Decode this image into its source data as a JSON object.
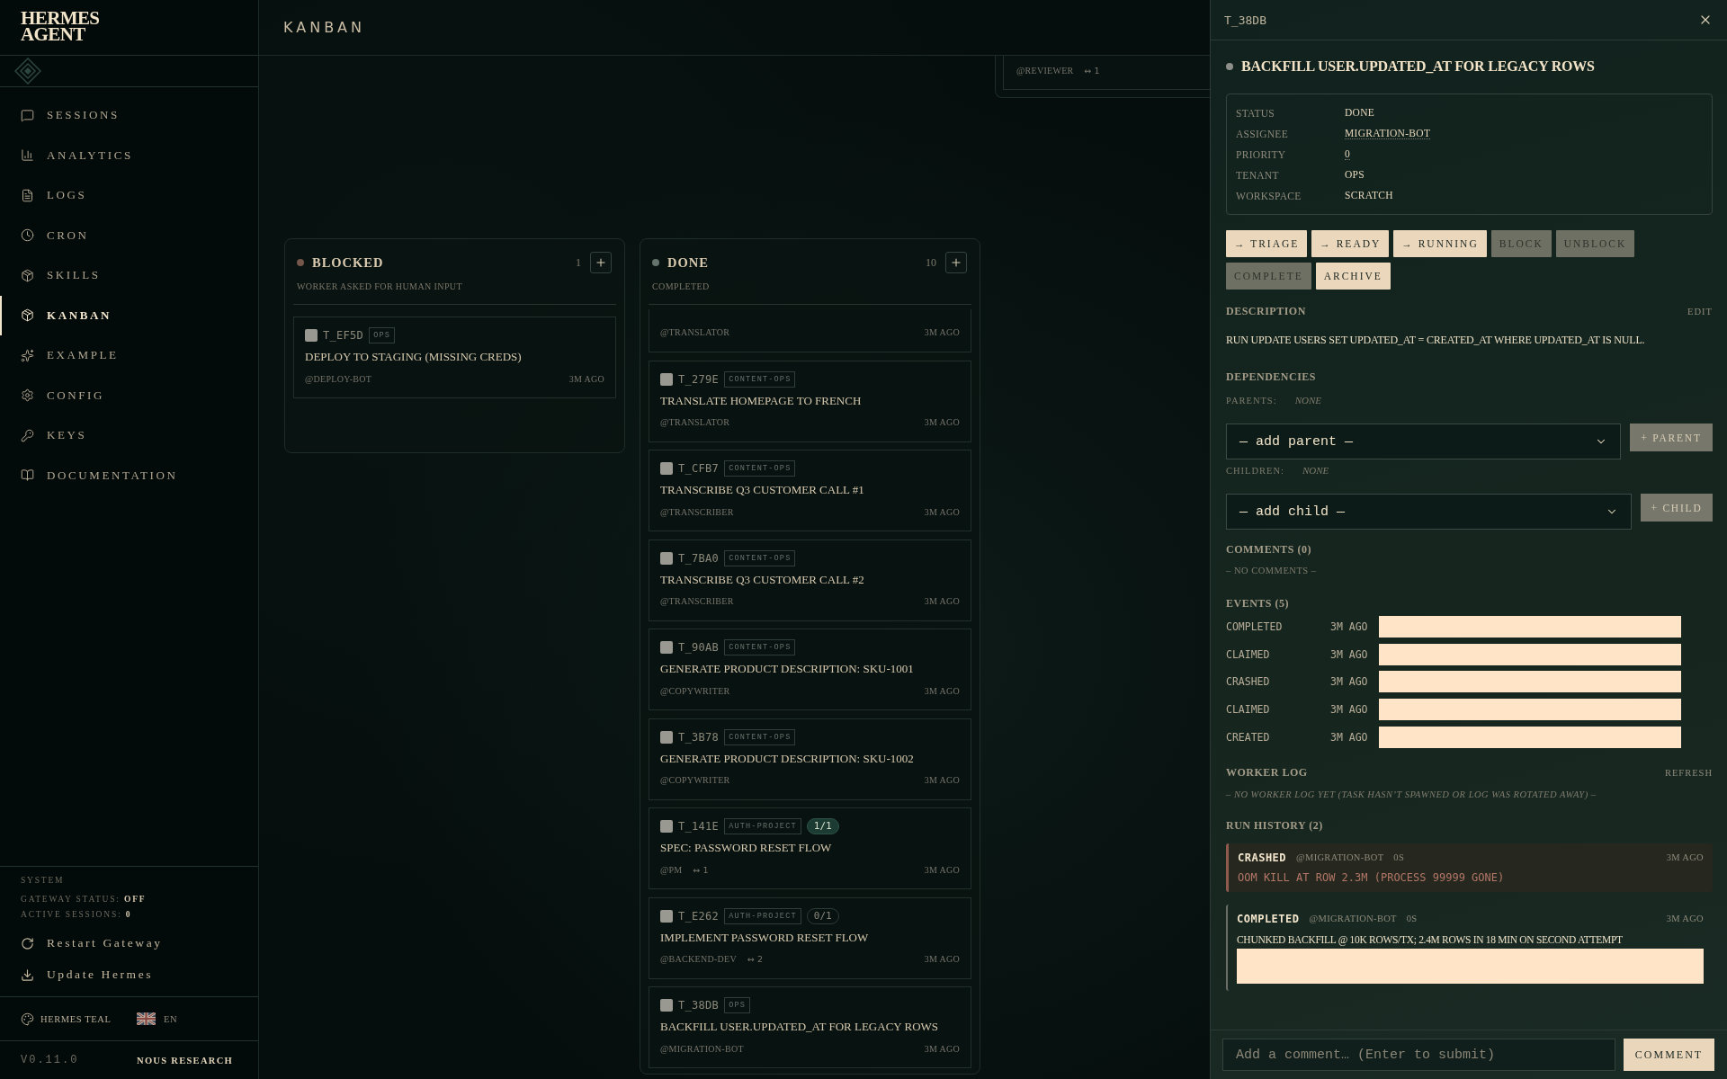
{
  "sidebar": {
    "logo": [
      "HERMES",
      "AGENT"
    ],
    "nav_items": [
      {
        "label": "SESSIONS",
        "selected": false
      },
      {
        "label": "ANALYTICS",
        "selected": false
      },
      {
        "label": "LOGS",
        "selected": false
      },
      {
        "label": "CRON",
        "selected": false
      },
      {
        "label": "SKILLS",
        "selected": false
      },
      {
        "label": "KANBAN",
        "selected": true
      },
      {
        "label": "EXAMPLE",
        "selected": false
      },
      {
        "label": "CONFIG",
        "selected": false
      },
      {
        "label": "KEYS",
        "selected": false
      },
      {
        "label": "DOCUMENTATION",
        "selected": false
      }
    ],
    "system": {
      "heading": "SYSTEM",
      "gateway": "GATEWAY STATUS: **OFF**",
      "sessions": "ACTIVE SESSIONS: **0**",
      "actions": [
        "Restart Gateway",
        "Update Hermes"
      ]
    },
    "theme": "HERMES TEAL",
    "language": "EN",
    "version": "V0.11.0",
    "credit": "NOUS RESEARCH"
  },
  "header": {
    "title": "KANBAN"
  },
  "board": {
    "clipped_card": {
      "assignee": "@REVIEWER",
      "links": "↔ 1"
    },
    "columns": [
      {
        "title": "BLOCKED",
        "color": "#74564b",
        "count": "1",
        "subtitle": "WORKER ASKED FOR HUMAN INPUT",
        "cards": [
          {
            "kind": "card",
            "checked": false,
            "id": "T_EF5D",
            "tag": "OPS",
            "title": "DEPLOY TO STAGING (MISSING CREDS)",
            "assignee": "@DEPLOY-BOT",
            "age": "3M AGO"
          }
        ]
      },
      {
        "title": "DONE",
        "color": "#64736c",
        "count": "10",
        "subtitle": "COMPLETED",
        "cards": [
          {
            "kind": "clipped",
            "assignee": "@TRANSLATOR",
            "age": "3M AGO"
          },
          {
            "kind": "card",
            "checked": false,
            "id": "T_279E",
            "tag": "CONTENT-OPS",
            "title": "TRANSLATE HOMEPAGE TO FRENCH",
            "assignee": "@TRANSLATOR",
            "age": "3M AGO"
          },
          {
            "kind": "card",
            "checked": false,
            "id": "T_CFB7",
            "tag": "CONTENT-OPS",
            "title": "TRANSCRIBE Q3 CUSTOMER CALL #1",
            "assignee": "@TRANSCRIBER",
            "age": "3M AGO"
          },
          {
            "kind": "card",
            "checked": false,
            "id": "T_7BA0",
            "tag": "CONTENT-OPS",
            "title": "TRANSCRIBE Q3 CUSTOMER CALL #2",
            "assignee": "@TRANSCRIBER",
            "age": "3M AGO"
          },
          {
            "kind": "card",
            "checked": false,
            "id": "T_90AB",
            "tag": "CONTENT-OPS",
            "title": "GENERATE PRODUCT DESCRIPTION: SKU-1001",
            "assignee": "@COPYWRITER",
            "age": "3M AGO"
          },
          {
            "kind": "card",
            "checked": false,
            "id": "T_3B78",
            "tag": "CONTENT-OPS",
            "title": "GENERATE PRODUCT DESCRIPTION: SKU-1002",
            "assignee": "@COPYWRITER",
            "age": "3M AGO"
          },
          {
            "kind": "card",
            "checked": false,
            "id": "T_141E",
            "tag": "AUTH-PROJECT",
            "progress": {
              "text": "1/1",
              "complete": true
            },
            "title": "SPEC: PASSWORD RESET FLOW",
            "assignee": "@PM",
            "links": "↔ 1",
            "age": "3M AGO"
          },
          {
            "kind": "card",
            "checked": false,
            "id": "T_E262",
            "tag": "AUTH-PROJECT",
            "progress": {
              "text": "0/1",
              "complete": false
            },
            "title": "IMPLEMENT PASSWORD RESET FLOW",
            "assignee": "@BACKEND-DEV",
            "links": "↔ 2",
            "age": "3M AGO"
          },
          {
            "kind": "card",
            "checked": false,
            "id": "T_38DB",
            "tag": "OPS",
            "title": "BACKFILL USER.UPDATED_AT FOR LEGACY ROWS",
            "assignee": "@MIGRATION-BOT",
            "age": "3M AGO"
          }
        ]
      }
    ]
  },
  "detail_panel": {
    "task_id": "T_38DB",
    "title": "BACKFILL USER.UPDATED_AT FOR LEGACY ROWS",
    "fields": [
      {
        "label": "STATUS",
        "value": "DONE",
        "editable": false
      },
      {
        "label": "ASSIGNEE",
        "value": "MIGRATION-BOT",
        "editable": true
      },
      {
        "label": "PRIORITY",
        "value": "0",
        "editable": true
      },
      {
        "label": "TENANT",
        "value": "OPS",
        "editable": false
      },
      {
        "label": "WORKSPACE",
        "value": "SCRATCH",
        "editable": false
      }
    ],
    "actions": [
      {
        "label": "→ TRIAGE",
        "disabled": false
      },
      {
        "label": "→ READY",
        "disabled": false
      },
      {
        "label": "→ RUNNING",
        "disabled": false
      },
      {
        "label": "BLOCK",
        "disabled": true
      },
      {
        "label": "UNBLOCK",
        "disabled": true
      },
      {
        "label": "COMPLETE",
        "disabled": true
      },
      {
        "label": "ARCHIVE",
        "disabled": false
      }
    ],
    "description": {
      "heading": "DESCRIPTION",
      "edit": "EDIT",
      "text": "RUN UPDATE USERS SET UPDATED_AT = CREATED_AT WHERE UPDATED_AT IS NULL."
    },
    "dependencies": {
      "heading": "DEPENDENCIES",
      "parents_label": "PARENTS:",
      "parents": "NONE",
      "parent_select": "— add parent —",
      "add_parent": "+ PARENT",
      "children_label": "CHILDREN:",
      "children": "NONE",
      "child_select": "— add child —",
      "add_child": "+ CHILD"
    },
    "comments": {
      "heading": "COMMENTS (0)",
      "empty": "– NO COMMENTS –"
    },
    "events": {
      "heading": "EVENTS (5)",
      "items": [
        {
          "event": "COMPLETED",
          "age": "3M AGO"
        },
        {
          "event": "CLAIMED",
          "age": "3M AGO"
        },
        {
          "event": "CRASHED",
          "age": "3M AGO"
        },
        {
          "event": "CLAIMED",
          "age": "3M AGO"
        },
        {
          "event": "CREATED",
          "age": "3M AGO"
        }
      ]
    },
    "worker_log": {
      "heading": "WORKER LOG",
      "refresh": "REFRESH",
      "empty": "– NO WORKER LOG YET (TASK HASN’T SPAWNED OR LOG WAS ROTATED AWAY) –"
    },
    "run_history": {
      "heading": "RUN HISTORY (2)",
      "runs": [
        {
          "kind": "crashed",
          "outcome": "CRASHED",
          "assignee": "@MIGRATION-BOT",
          "duration": "0S",
          "age": "3M AGO",
          "detail": "OOM KILL AT ROW 2.3M (PROCESS 99999 GONE)"
        },
        {
          "kind": "completed",
          "outcome": "COMPLETED",
          "assignee": "@MIGRATION-BOT",
          "duration": "0S",
          "age": "3M AGO",
          "detail": "CHUNKED BACKFILL @ 10K ROWS/TX; 2.4M ROWS IN 18 MIN ON SECOND ATTEMPT"
        }
      ]
    },
    "comment_box": {
      "placeholder": "Add a comment… (Enter to submit)",
      "button": "COMMENT"
    }
  }
}
